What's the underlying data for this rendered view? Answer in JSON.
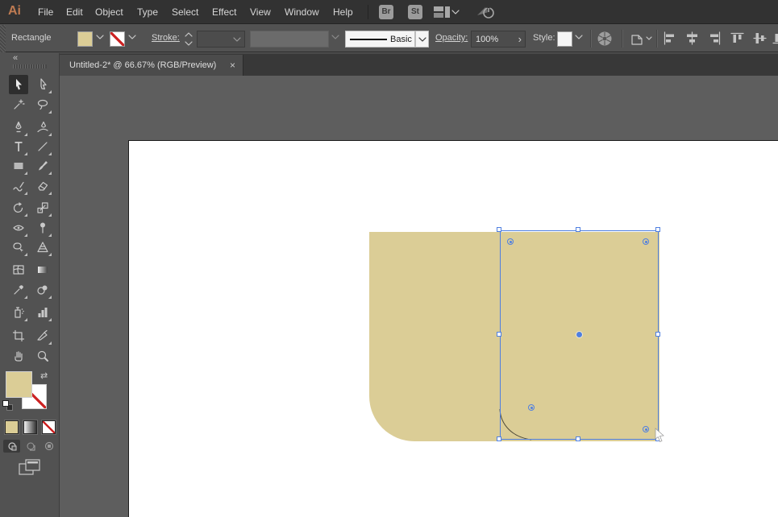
{
  "app": {
    "logo_text": "Ai"
  },
  "menubar": {
    "items": [
      "File",
      "Edit",
      "Object",
      "Type",
      "Select",
      "Effect",
      "View",
      "Window",
      "Help"
    ],
    "bridge_label": "Br",
    "stock_label": "St"
  },
  "controlbar": {
    "selection_type_label": "Rectangle",
    "stroke_label": "Stroke:",
    "brush_style_value": "Basic",
    "opacity_label": "Opacity:",
    "opacity_value": "100%",
    "opacity_arrow_glyph": "›",
    "style_label": "Style:"
  },
  "document_tab": {
    "title": "Untitled-2* @ 66.67% (RGB/Preview)",
    "close_glyph": "×"
  },
  "toolbar": {
    "collapse_glyph": "«",
    "swap_fill_stroke_glyph": "⇄"
  },
  "colors": {
    "object_fill": "#dbcd96",
    "selection_blue": "#4f7fe0",
    "stroke_none_red": "#cc2222",
    "pasteboard_gray": "#5e5e5e",
    "artboard_white": "#ffffff",
    "ui_dark": "#323232",
    "ui_panel": "#525252"
  }
}
